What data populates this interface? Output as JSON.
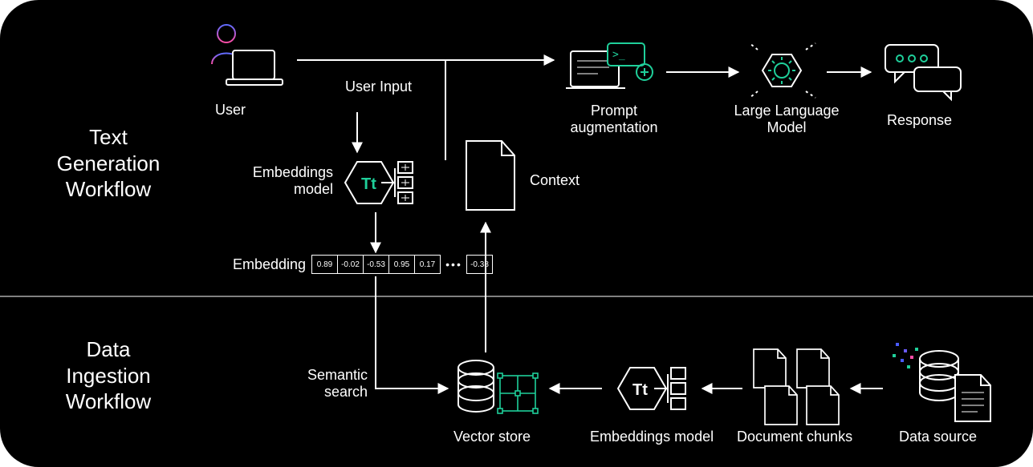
{
  "sections": {
    "top": "Text\nGeneration\nWorkflow",
    "bottom": "Data\nIngestion\nWorkflow"
  },
  "top": {
    "user": "User",
    "user_input": "User Input",
    "embeddings_model": "Embeddings\nmodel",
    "context": "Context",
    "embedding": "Embedding",
    "embedding_values": [
      "0.89",
      "-0.02",
      "-0.53",
      "0.95",
      "0.17",
      "…",
      "-0.38"
    ],
    "prompt_aug": "Prompt\naugmentation",
    "llm": "Large Language\nModel",
    "response": "Response"
  },
  "bottom": {
    "semantic_search": "Semantic\nsearch",
    "vector_store": "Vector store",
    "embeddings_model": "Embeddings model",
    "doc_chunks": "Document chunks",
    "data_source": "Data source"
  }
}
